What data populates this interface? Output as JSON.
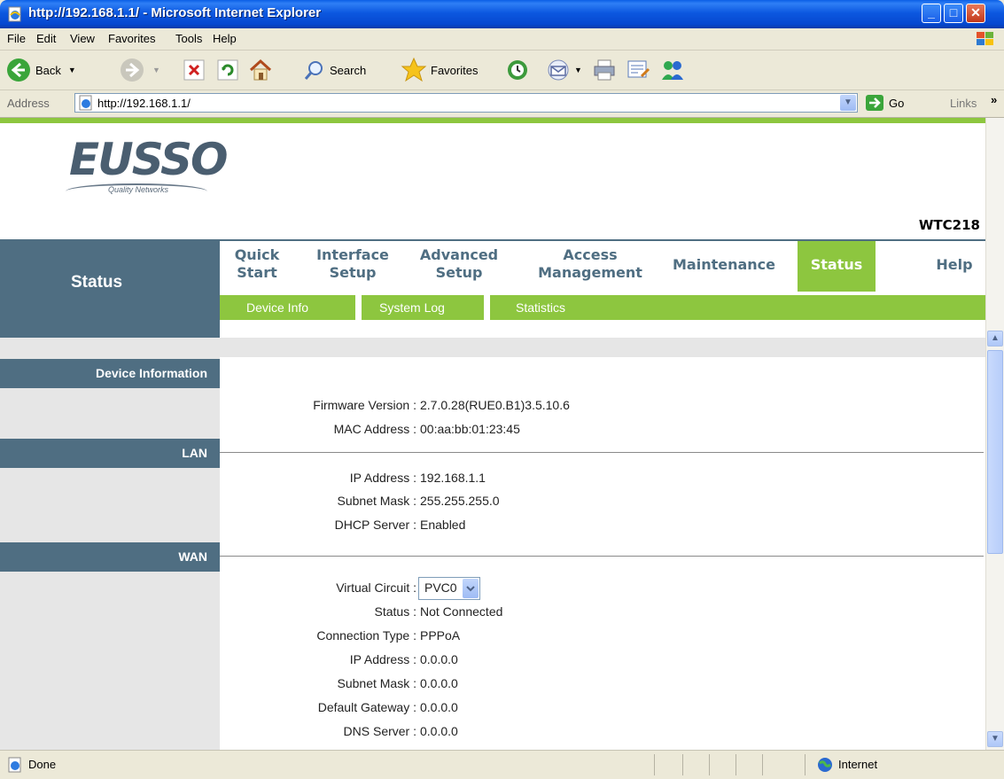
{
  "window": {
    "title": "http://192.168.1.1/ - Microsoft Internet Explorer"
  },
  "menu": [
    "File",
    "Edit",
    "View",
    "Favorites",
    "Tools",
    "Help"
  ],
  "toolbar": {
    "back": "Back",
    "search": "Search",
    "favorites": "Favorites"
  },
  "address": {
    "label": "Address",
    "url": "http://192.168.1.1/",
    "go": "Go",
    "links": "Links"
  },
  "header": {
    "brand": "EUSSO",
    "tagline": "Quality Networks",
    "model": "WTC218"
  },
  "nav": {
    "section_title": "Status",
    "items": [
      {
        "line1": "Quick",
        "line2": "Start"
      },
      {
        "line1": "Interface",
        "line2": "Setup"
      },
      {
        "line1": "Advanced",
        "line2": "Setup"
      },
      {
        "line1": "Access",
        "line2": "Management"
      },
      {
        "line1": "Maintenance",
        "line2": ""
      },
      {
        "line1": "Status",
        "line2": ""
      },
      {
        "line1": "Help",
        "line2": ""
      }
    ],
    "active": "Status",
    "subnav": [
      "Device Info",
      "System Log",
      "Statistics"
    ]
  },
  "sections": {
    "device": {
      "title": "Device Information",
      "rows": [
        {
          "label": "Firmware Version :",
          "value": "2.7.0.28(RUE0.B1)3.5.10.6"
        },
        {
          "label": "MAC Address :",
          "value": "00:aa:bb:01:23:45"
        }
      ]
    },
    "lan": {
      "title": "LAN",
      "rows": [
        {
          "label": "IP Address :",
          "value": "192.168.1.1"
        },
        {
          "label": "Subnet Mask :",
          "value": "255.255.255.0"
        },
        {
          "label": "DHCP Server :",
          "value": "Enabled"
        }
      ]
    },
    "wan": {
      "title": "WAN",
      "virtual_circuit_label": "Virtual Circuit :",
      "virtual_circuit_value": "PVC0",
      "rows": [
        {
          "label": "Status :",
          "value": "Not Connected"
        },
        {
          "label": "Connection Type :",
          "value": "PPPoA"
        },
        {
          "label": "IP Address :",
          "value": "0.0.0.0"
        },
        {
          "label": "Subnet Mask :",
          "value": "0.0.0.0"
        },
        {
          "label": "Default Gateway :",
          "value": "0.0.0.0"
        },
        {
          "label": "DNS Server :",
          "value": "0.0.0.0"
        }
      ]
    }
  },
  "statusbar": {
    "left": "Done",
    "zone": "Internet"
  },
  "colors": {
    "accent_green": "#8dc63f",
    "nav_slate": "#4f6e82",
    "xp_blue": "#0c58e0"
  }
}
